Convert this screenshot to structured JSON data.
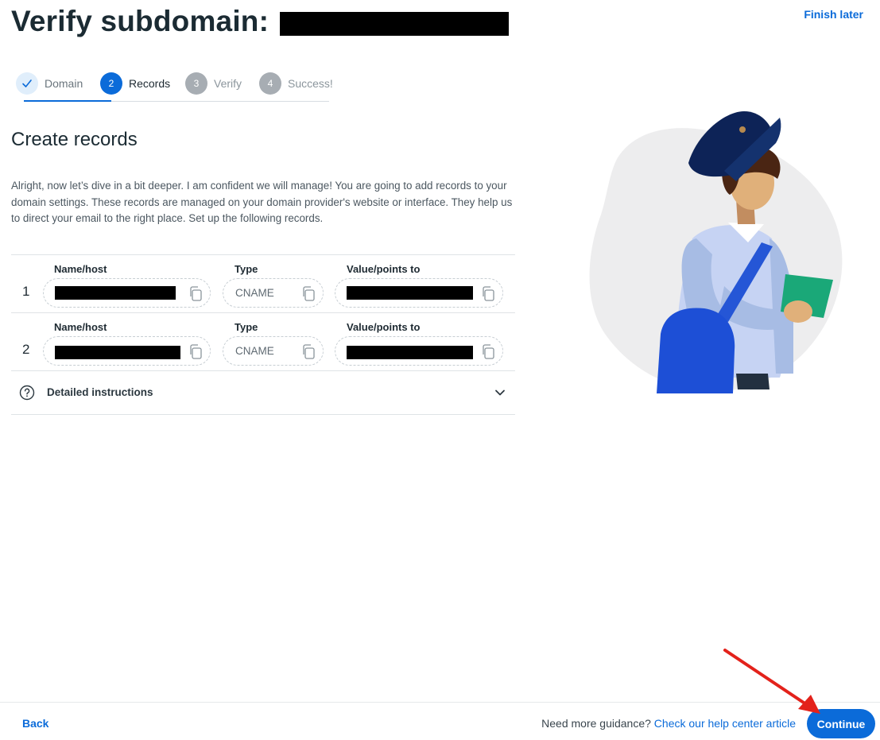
{
  "header": {
    "title": "Verify subdomain:",
    "finish_later": "Finish later"
  },
  "stepper": {
    "steps": [
      {
        "number": "",
        "label": "Domain",
        "state": "done"
      },
      {
        "number": "2",
        "label": "Records",
        "state": "active"
      },
      {
        "number": "3",
        "label": "Verify",
        "state": "pending"
      },
      {
        "number": "4",
        "label": "Success!",
        "state": "pending"
      }
    ]
  },
  "main": {
    "section_title": "Create records",
    "intro": "Alright, now let’s dive in a bit deeper. I am confident we will manage! You are going to add records to your domain settings. These records are managed on your domain provider's website or interface. They help us to direct your email to the right place. Set up the following records.",
    "column_labels": {
      "name": "Name/host",
      "type": "Type",
      "value": "Value/points to"
    },
    "records": [
      {
        "number": "1",
        "type": "CNAME"
      },
      {
        "number": "2",
        "type": "CNAME"
      }
    ],
    "detailed_instructions": "Detailed instructions"
  },
  "footer": {
    "back": "Back",
    "guidance_text": "Need more guidance?",
    "guidance_link": "Check our help center article",
    "continue": "Continue"
  },
  "colors": {
    "accent": "#0b6bd9",
    "annotation_arrow": "#e3221b"
  }
}
